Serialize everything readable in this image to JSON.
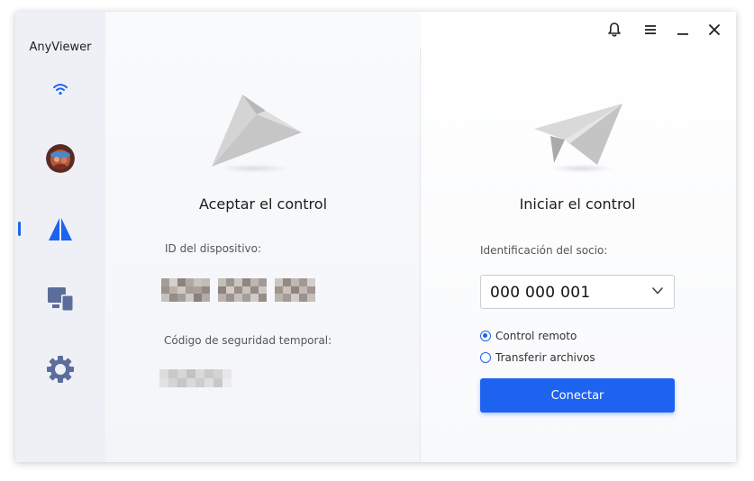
{
  "app": {
    "name": "AnyViewer"
  },
  "sidebar": {
    "items": [
      {
        "name": "wifi-status",
        "icon": "wifi-icon"
      },
      {
        "name": "account",
        "icon": "avatar"
      },
      {
        "name": "remote-control",
        "icon": "anyviewer-logo-icon",
        "active": true
      },
      {
        "name": "devices",
        "icon": "devices-icon"
      },
      {
        "name": "settings",
        "icon": "gear-icon"
      }
    ],
    "active_color": "#1e63f0",
    "icon_color": "#5b6e9b"
  },
  "titlebar": {
    "icons": [
      "bell-icon",
      "menu-icon",
      "minimize-icon",
      "close-icon"
    ]
  },
  "accept": {
    "title": "Aceptar el control",
    "device_id_label": "ID del dispositivo:",
    "security_code_label": "Código de seguridad temporal:"
  },
  "initiate": {
    "title": "Iniciar el control",
    "partner_label": "Identificación del socio:",
    "partner_value": "000 000 001",
    "options": [
      {
        "label": "Control remoto",
        "checked": true
      },
      {
        "label": "Transferir archivos",
        "checked": false
      }
    ],
    "connect_label": "Conectar"
  },
  "colors": {
    "accent": "#1e63f0"
  }
}
